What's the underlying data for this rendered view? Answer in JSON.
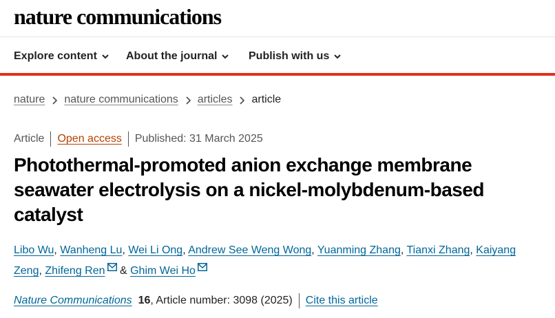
{
  "site": {
    "logo": "nature communications"
  },
  "nav": {
    "items": [
      {
        "label": "Explore content"
      },
      {
        "label": "About the journal"
      },
      {
        "label": "Publish with us"
      }
    ]
  },
  "breadcrumb": {
    "items": [
      "nature",
      "nature communications",
      "articles"
    ],
    "current": "article"
  },
  "article": {
    "type": "Article",
    "access": "Open access",
    "published": "Published: 31 March 2025",
    "title": "Photothermal-promoted anion exchange membrane seawater electrolysis on a nickel-molybdenum-based catalyst",
    "authors": [
      "Libo Wu",
      "Wanheng Lu",
      "Wei Li Ong",
      "Andrew See Weng Wong",
      "Yuanming Zhang",
      "Tianxi Zhang",
      "Kaiyang Zeng",
      "Zhifeng Ren",
      "Ghim Wei Ho"
    ],
    "separators": {
      "comma": ", ",
      "and": " & "
    },
    "journal": "Nature Communications",
    "volume": "16",
    "article_number": ", Article number: 3098 (2025)",
    "cite_label": "Cite this article"
  },
  "colors": {
    "accent_red": "#e0301e",
    "link_blue": "#006699",
    "open_access_orange": "#b44100"
  }
}
